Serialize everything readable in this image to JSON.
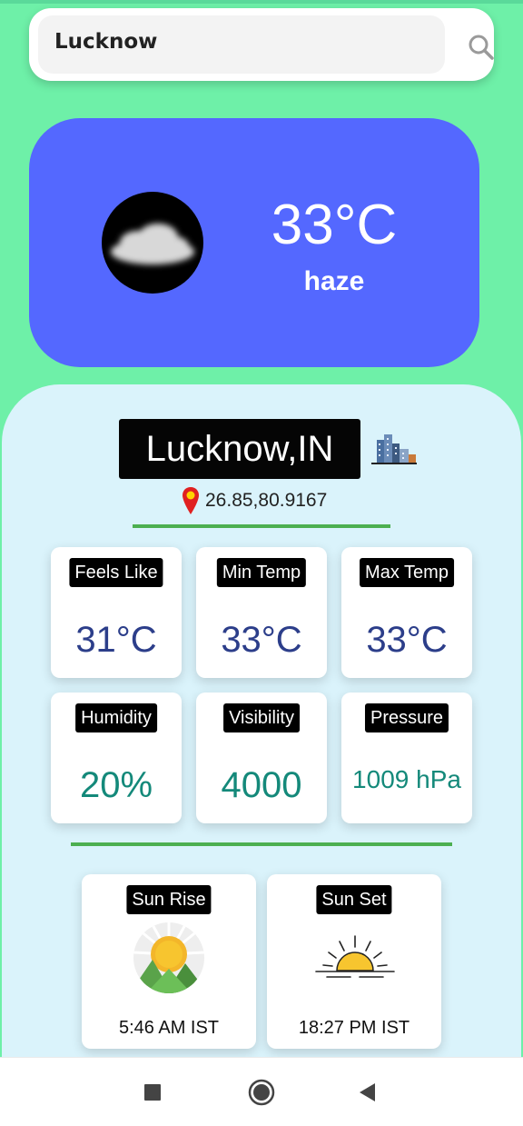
{
  "search": {
    "value": "Lucknow",
    "icon": "search-icon"
  },
  "current": {
    "temperature": "33°C",
    "description": "haze",
    "icon": "haze-cloud-icon"
  },
  "location": {
    "city": "Lucknow,IN",
    "coordinates": "26.85,80.9167",
    "city_icon": "city-buildings-icon",
    "pin_icon": "location-pin-icon"
  },
  "stats": [
    {
      "label": "Feels Like",
      "value": "31°C"
    },
    {
      "label": "Min Temp",
      "value": "33°C"
    },
    {
      "label": "Max Temp",
      "value": "33°C"
    },
    {
      "label": "Humidity",
      "value": "20%"
    },
    {
      "label": "Visibility",
      "value": "4000"
    },
    {
      "label": "Pressure",
      "value": "1009 hPa"
    }
  ],
  "sun": {
    "sunrise": {
      "label": "Sun Rise",
      "time": "5:46 AM IST",
      "icon": "sunrise-icon"
    },
    "sunset": {
      "label": "Sun Set",
      "time": "18:27 PM IST",
      "icon": "sunset-icon"
    }
  },
  "navbar": {
    "recents": "square-icon",
    "home": "circle-icon",
    "back": "triangle-back-icon"
  },
  "colors": {
    "background": "#6ef0a8",
    "hero": "#5468ff",
    "panel": "#daf3fb",
    "divider": "#4caf50",
    "navy_value": "#2c3e8a",
    "teal_value": "#14897a"
  }
}
